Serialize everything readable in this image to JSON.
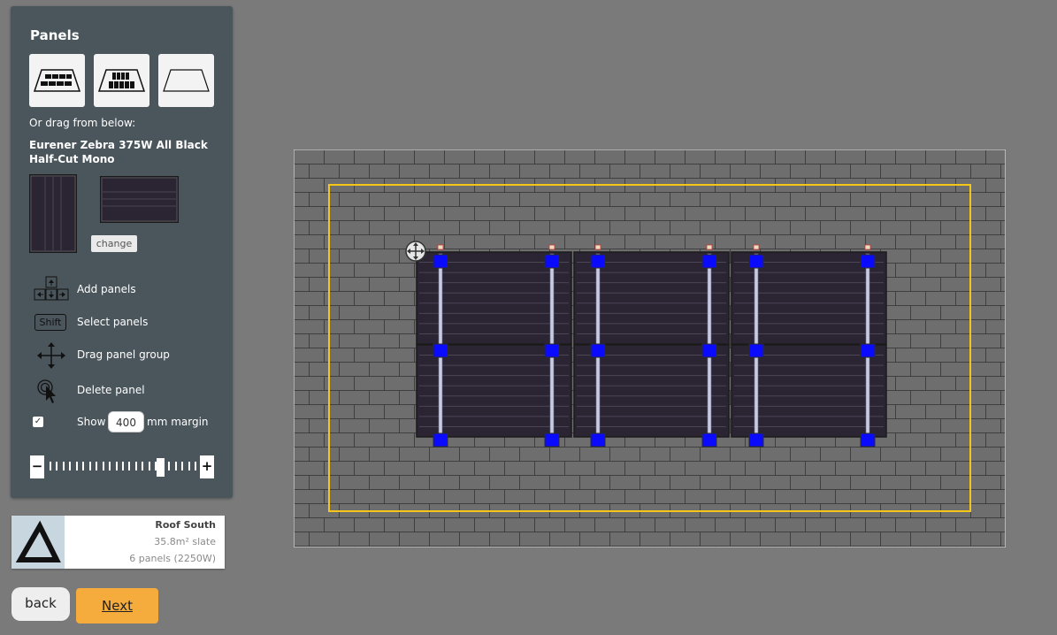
{
  "sidebar": {
    "title": "Panels",
    "layout_buttons": [
      {
        "name": "landscape-layout"
      },
      {
        "name": "portrait-layout"
      },
      {
        "name": "empty-layout"
      }
    ],
    "drag_hint": "Or drag from below:",
    "panel_model": "Eurener Zebra 375W All Black Half-Cut Mono",
    "change_label": "change",
    "help": [
      {
        "icon": "arrow-keys-icon",
        "label": "Add panels"
      },
      {
        "icon": "shift-key-icon",
        "key": "Shift",
        "label": "Select panels"
      },
      {
        "icon": "move-icon",
        "label": "Drag panel group"
      },
      {
        "icon": "click-cursor-icon",
        "label": "Delete panel"
      }
    ],
    "margin": {
      "checked": true,
      "show_label": "Show",
      "value": "400",
      "unit_label": "mm margin"
    },
    "zoom": {
      "minus": "−",
      "plus": "+",
      "level_fraction": 0.75
    }
  },
  "roof_card": {
    "name": "Roof South",
    "area": "35.8m² slate",
    "panels": "6 panels (2250W)"
  },
  "buttons": {
    "back": "back",
    "next": "Next"
  },
  "colors": {
    "sidebar_bg": "#4a555c",
    "margin_outline": "#f5c518",
    "panel_fill": "#2b2433",
    "clamp_blue": "#0a0aff",
    "rail": "#c8ccdd",
    "next_accent": "#f5ac3c"
  }
}
